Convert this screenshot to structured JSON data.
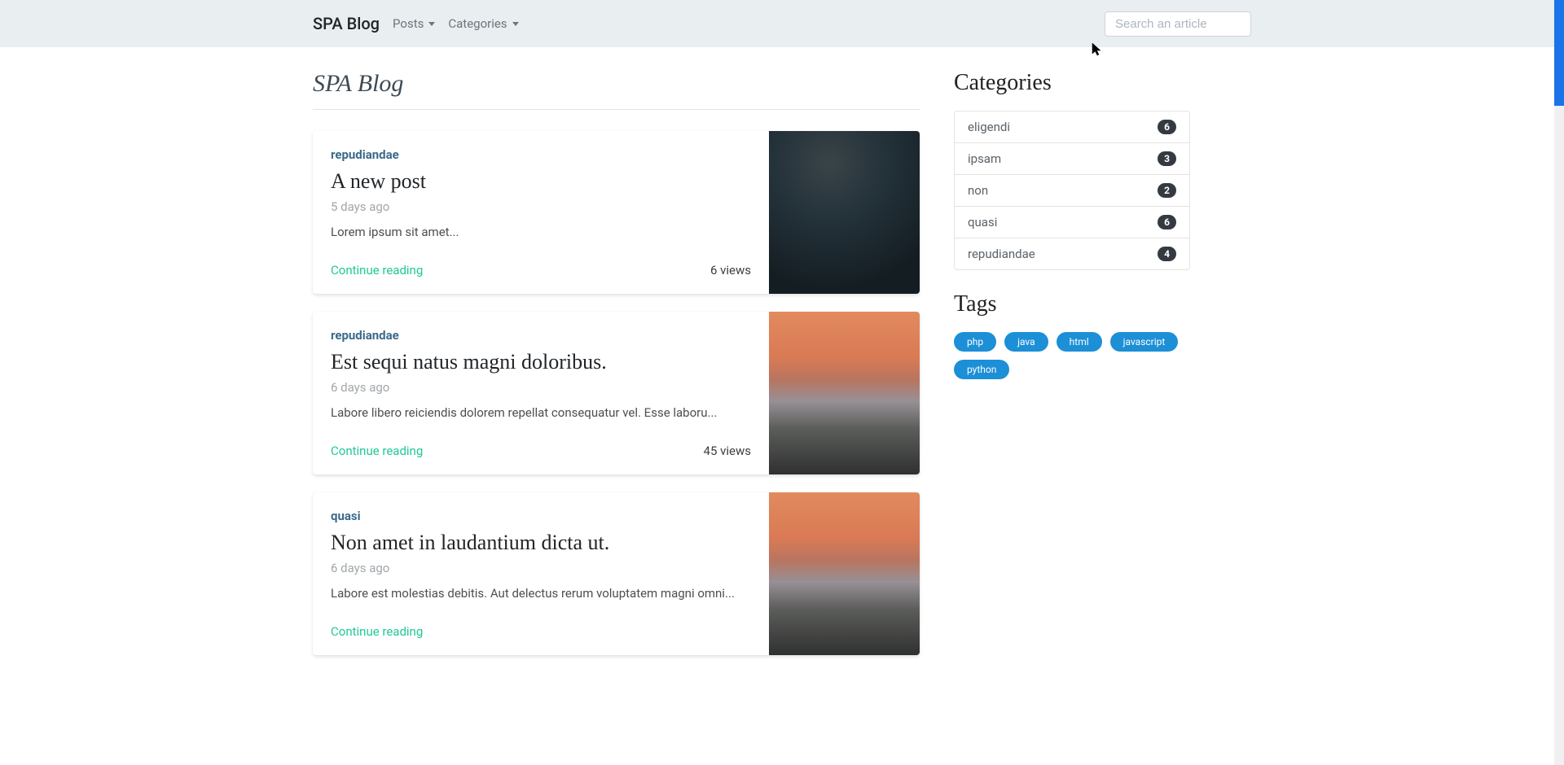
{
  "nav": {
    "brand": "SPA Blog",
    "links": [
      {
        "label": "Posts"
      },
      {
        "label": "Categories"
      }
    ],
    "search_placeholder": "Search an article"
  },
  "page": {
    "title": "SPA Blog"
  },
  "posts": [
    {
      "category": "repudiandae",
      "title": "A new post",
      "time": "5 days ago",
      "excerpt": "Lorem ipsum sit amet...",
      "continue": "Continue reading",
      "views": "6 views",
      "thumb": "dark"
    },
    {
      "category": "repudiandae",
      "title": "Est sequi natus magni doloribus.",
      "time": "6 days ago",
      "excerpt": "Labore libero reiciendis dolorem repellat consequatur vel. Esse laboru...",
      "continue": "Continue reading",
      "views": "45 views",
      "thumb": "sunset"
    },
    {
      "category": "quasi",
      "title": "Non amet in laudantium dicta ut.",
      "time": "6 days ago",
      "excerpt": "Labore est molestias debitis. Aut delectus rerum voluptatem magni omni...",
      "continue": "Continue reading",
      "views": "",
      "thumb": "sunset"
    }
  ],
  "sidebar": {
    "categories_heading": "Categories",
    "categories": [
      {
        "name": "eligendi",
        "count": "6"
      },
      {
        "name": "ipsam",
        "count": "3"
      },
      {
        "name": "non",
        "count": "2"
      },
      {
        "name": "quasi",
        "count": "6"
      },
      {
        "name": "repudiandae",
        "count": "4"
      }
    ],
    "tags_heading": "Tags",
    "tags": [
      "php",
      "java",
      "html",
      "javascript",
      "python"
    ]
  }
}
